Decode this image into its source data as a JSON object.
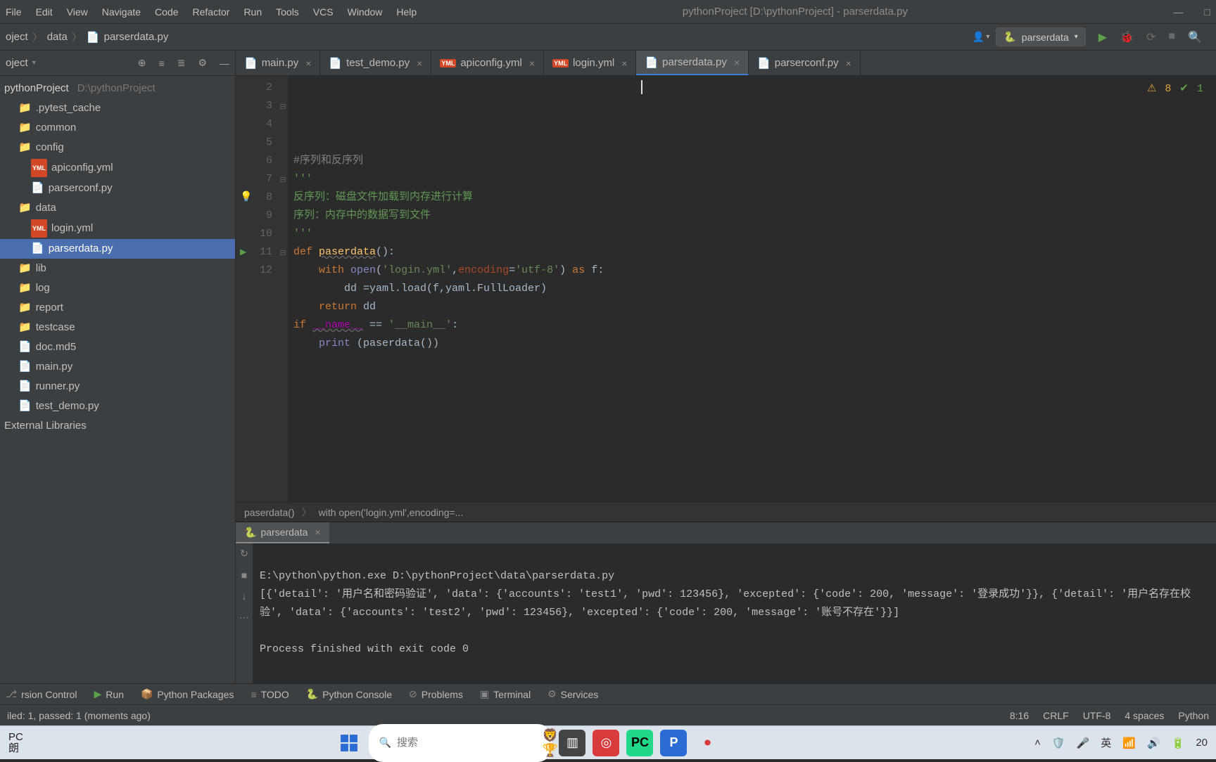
{
  "window": {
    "title": "pythonProject [D:\\pythonProject] - parserdata.py"
  },
  "menubar": {
    "file": "File",
    "edit": "Edit",
    "view": "View",
    "navigate": "Navigate",
    "code": "Code",
    "refactor": "Refactor",
    "run": "Run",
    "tools": "Tools",
    "vcs": "VCS",
    "window": "Window",
    "help": "Help"
  },
  "breadcrumb": {
    "root": "oject",
    "folder": "data",
    "file": "parserdata.py"
  },
  "runconfig": {
    "name": "parserdata"
  },
  "project": {
    "label": "oject",
    "root_name": "pythonProject",
    "root_path": "D:\\pythonProject",
    "items": {
      "pytest_cache": ".pytest_cache",
      "common": "common",
      "config": "config",
      "apiconfig": "apiconfig.yml",
      "parserconf": "parserconf.py",
      "data": "data",
      "login_yml": "login.yml",
      "parserdata_py": "parserdata.py",
      "lib": "lib",
      "log": "log",
      "report": "report",
      "testcase": "testcase",
      "doc": "doc.md5",
      "main_py": "main.py",
      "runner_py": "runner.py",
      "test_demo_py": "test_demo.py",
      "ext_lib": "External Libraries"
    }
  },
  "tabs": [
    {
      "label": "main.py",
      "type": "py"
    },
    {
      "label": "test_demo.py",
      "type": "py"
    },
    {
      "label": "apiconfig.yml",
      "type": "yml"
    },
    {
      "label": "login.yml",
      "type": "yml"
    },
    {
      "label": "parserdata.py",
      "type": "py",
      "active": true
    },
    {
      "label": "parserconf.py",
      "type": "py"
    }
  ],
  "inspection": {
    "warnings": "8",
    "ok": "1"
  },
  "code": {
    "lines": [
      {
        "n": "2",
        "frag": [
          {
            "c": "c-comment",
            "t": "#序列和反序列"
          }
        ]
      },
      {
        "n": "3",
        "frag": [
          {
            "c": "c-docstr",
            "t": "'''"
          }
        ]
      },
      {
        "n": "4",
        "frag": [
          {
            "c": "c-docstr",
            "t": "反序列：磁盘文件加载到内存进行计算"
          }
        ]
      },
      {
        "n": "5",
        "frag": [
          {
            "c": "c-docstr",
            "t": "序列：内存中的数据写到文件"
          }
        ]
      },
      {
        "n": "6",
        "frag": [
          {
            "c": "c-docstr",
            "t": "'''"
          }
        ]
      },
      {
        "n": "7",
        "frag": [
          {
            "c": "c-keyword",
            "t": "def "
          },
          {
            "c": "c-func",
            "t": "paserdata"
          },
          {
            "c": "",
            "t": "():"
          }
        ]
      },
      {
        "n": "8",
        "bulb": true,
        "frag": [
          {
            "c": "",
            "t": "    "
          },
          {
            "c": "c-keyword",
            "t": "with "
          },
          {
            "c": "c-builtin",
            "t": "open"
          },
          {
            "c": "",
            "t": "("
          },
          {
            "c": "c-string",
            "t": "'login.yml'"
          },
          {
            "c": "",
            "t": ","
          },
          {
            "c": "c-param",
            "t": "encoding"
          },
          {
            "c": "",
            "t": "="
          },
          {
            "c": "c-string",
            "t": "'utf-8'"
          },
          {
            "c": "",
            "t": ") "
          },
          {
            "c": "c-keyword",
            "t": "as "
          },
          {
            "c": "",
            "t": "f:"
          }
        ]
      },
      {
        "n": "9",
        "frag": [
          {
            "c": "",
            "t": "        dd =yaml.load(f,yaml.FullLoader)"
          }
        ]
      },
      {
        "n": "10",
        "frag": [
          {
            "c": "",
            "t": "    "
          },
          {
            "c": "c-keyword",
            "t": "return "
          },
          {
            "c": "",
            "t": "dd"
          }
        ]
      },
      {
        "n": "11",
        "run": true,
        "frag": [
          {
            "c": "c-keyword",
            "t": "if "
          },
          {
            "c": "c-dunder",
            "t": "__name__"
          },
          {
            "c": "",
            "t": " == "
          },
          {
            "c": "c-string",
            "t": "'__main__'"
          },
          {
            "c": "",
            "t": ":"
          }
        ]
      },
      {
        "n": "12",
        "frag": [
          {
            "c": "",
            "t": "    "
          },
          {
            "c": "c-builtin",
            "t": "print"
          },
          {
            "c": "",
            "t": " (paserdata())"
          }
        ]
      }
    ]
  },
  "editor_crumb": {
    "a": "paserdata()",
    "b": "with open('login.yml',encoding=..."
  },
  "run_tab": {
    "label": "parserdata"
  },
  "run_output": {
    "line1": "E:\\python\\python.exe D:\\pythonProject\\data\\parserdata.py",
    "line2": "[{'detail': '用户名和密码验证', 'data': {'accounts': 'test1', 'pwd': 123456}, 'excepted': {'code': 200, 'message': '登录成功'}}, {'detail': '用户名存在校验', 'data': {'accounts': 'test2', 'pwd': 123456}, 'excepted': {'code': 200, 'message': '账号不存在'}}]",
    "line3": "",
    "line4": "Process finished with exit code 0"
  },
  "tool_tabs": {
    "version_control": "rsion Control",
    "run": "Run",
    "py_packages": "Python Packages",
    "todo": "TODO",
    "py_console": "Python Console",
    "problems": "Problems",
    "terminal": "Terminal",
    "services": "Services"
  },
  "statusbar": {
    "left": "iled: 1, passed: 1 (moments ago)",
    "pos": "8:16",
    "eol": "CRLF",
    "encoding": "UTF-8",
    "indent": "4 spaces",
    "interp": "Python"
  },
  "taskbar": {
    "widget_line1": "PC",
    "widget_line2": "朗",
    "search_placeholder": "搜索",
    "ime": "英",
    "date": "20"
  }
}
